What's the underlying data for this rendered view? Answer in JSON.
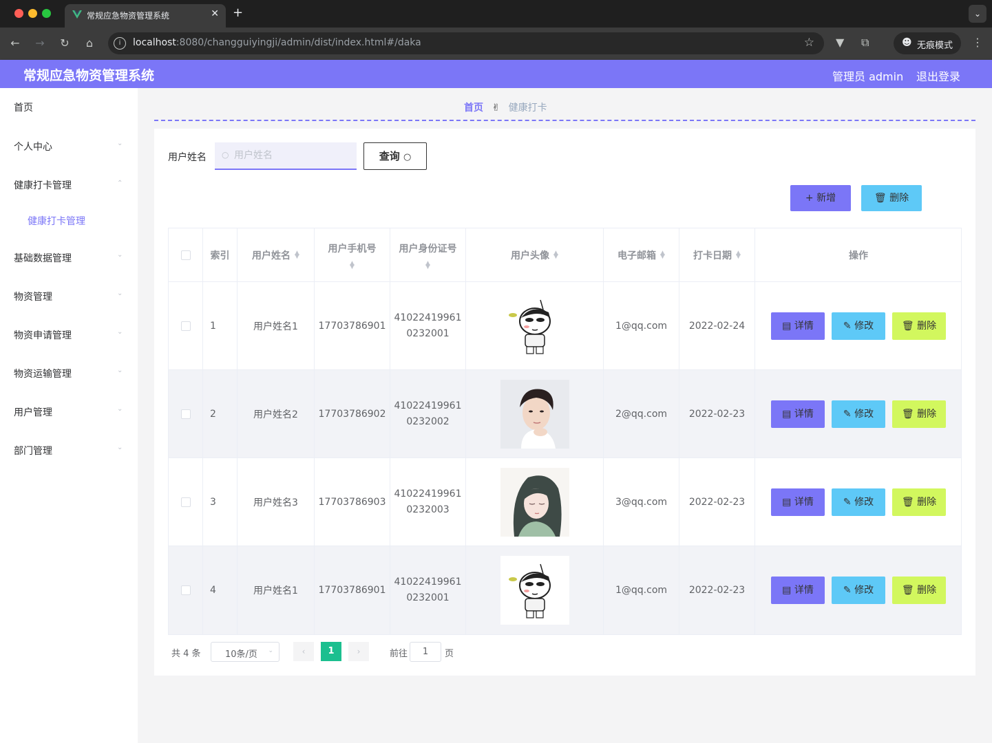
{
  "browser": {
    "tab_title": "常规应急物资管理系统",
    "url_host": "localhost",
    "url_rest": ":8080/changguiyingji/admin/dist/index.html#/daka",
    "incognito_label": "无痕模式"
  },
  "header": {
    "title": "常规应急物资管理系统",
    "user": "管理员 admin",
    "logout": "退出登录"
  },
  "sidebar": {
    "items": [
      {
        "label": "首页"
      },
      {
        "label": "个人中心"
      },
      {
        "label": "健康打卡管理"
      },
      {
        "label": "健康打卡管理"
      },
      {
        "label": "基础数据管理"
      },
      {
        "label": "物资管理"
      },
      {
        "label": "物资申请管理"
      },
      {
        "label": "物资运输管理"
      },
      {
        "label": "用户管理"
      },
      {
        "label": "部门管理"
      }
    ]
  },
  "breadcrumb": {
    "home": "首页",
    "separator": "✌",
    "current": "健康打卡"
  },
  "search": {
    "label": "用户姓名",
    "placeholder": "用户姓名",
    "query_button": "查询"
  },
  "actions": {
    "add": "新增",
    "delete": "删除"
  },
  "table": {
    "columns": [
      "索引",
      "用户姓名",
      "用户手机号",
      "用户身份证号",
      "用户头像",
      "电子邮箱",
      "打卡日期",
      "操作"
    ],
    "rows": [
      {
        "index": "1",
        "name": "用户姓名1",
        "phone": "17703786901",
        "id_a": "41022419961",
        "id_b": "0232001",
        "avatar": "cartoon-boy",
        "email": "1@qq.com",
        "date": "2022-02-24"
      },
      {
        "index": "2",
        "name": "用户姓名2",
        "phone": "17703786902",
        "id_a": "41022419961",
        "id_b": "0232002",
        "avatar": "young-man-photo",
        "email": "2@qq.com",
        "date": "2022-02-23"
      },
      {
        "index": "3",
        "name": "用户姓名3",
        "phone": "17703786903",
        "id_a": "41022419961",
        "id_b": "0232003",
        "avatar": "anime-girl",
        "email": "3@qq.com",
        "date": "2022-02-23"
      },
      {
        "index": "4",
        "name": "用户姓名1",
        "phone": "17703786901",
        "id_a": "41022419961",
        "id_b": "0232001",
        "avatar": "cartoon-boy",
        "email": "1@qq.com",
        "date": "2022-02-23"
      }
    ],
    "op_detail": "详情",
    "op_edit": "修改",
    "op_delete": "删除"
  },
  "pagination": {
    "total": "共 4 条",
    "page_size": "10条/页",
    "current_page": "1",
    "goto_label": "前往",
    "goto_value": "1",
    "page_suffix": "页"
  },
  "colors": {
    "accent": "#7b76f7",
    "edit": "#5ec9f7",
    "delete": "#d2f75e",
    "page_active": "#1bbf8f"
  }
}
